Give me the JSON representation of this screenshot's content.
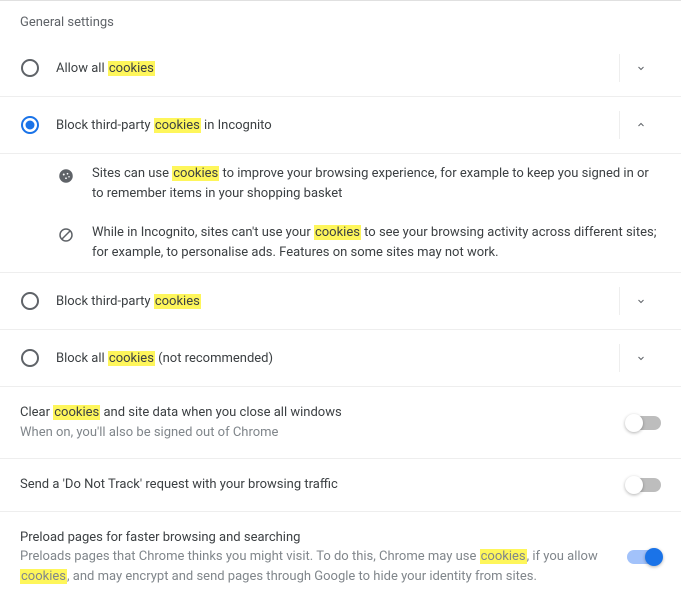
{
  "section_title": "General settings",
  "highlight_term": "cookies",
  "options": {
    "o0": {
      "pre": "Allow all ",
      "hl": "cookies",
      "post": "",
      "selected": false,
      "expanded": false
    },
    "o1": {
      "pre": "Block third-party ",
      "hl": "cookies",
      "post": " in Incognito",
      "selected": true,
      "expanded": true
    },
    "o2": {
      "pre": "Block third-party ",
      "hl": "cookies",
      "post": "",
      "selected": false,
      "expanded": false
    },
    "o3": {
      "pre": "Block all ",
      "hl": "cookies",
      "post": " (not recommended)",
      "selected": false,
      "expanded": false
    }
  },
  "detail": {
    "d0": {
      "pre": "Sites can use ",
      "hl": "cookies",
      "post": " to improve your browsing experience, for example to keep you signed in or to remember items in your shopping basket"
    },
    "d1": {
      "pre": "While in Incognito, sites can't use your ",
      "hl": "cookies",
      "post": " to see your browsing activity across different sites; for example, to personalise ads. Features on some sites may not work."
    }
  },
  "toggles": {
    "clear": {
      "title_pre": "Clear ",
      "title_hl": "cookies",
      "title_post": " and site data when you close all windows",
      "sub": "When on, you'll also be signed out of Chrome",
      "on": false
    },
    "dnt": {
      "title": "Send a 'Do Not Track' request with your browsing traffic",
      "on": false
    },
    "preload": {
      "title": "Preload pages for faster browsing and searching",
      "sub_a": "Preloads pages that Chrome thinks you might visit. To do this, Chrome may use ",
      "sub_hl1": "cookies",
      "sub_b": ", if you allow ",
      "sub_hl2": "cookies",
      "sub_c": ", and may encrypt and send pages through Google to hide your identity from sites.",
      "on": true
    }
  }
}
